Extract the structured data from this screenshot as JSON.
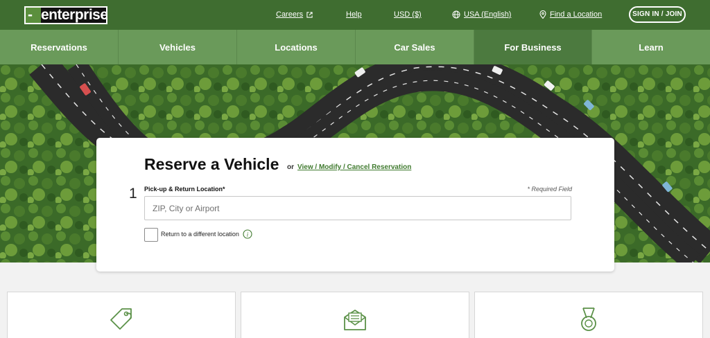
{
  "brand": {
    "logo_text": "enterprise"
  },
  "topbar": {
    "links": [
      {
        "label": "Careers",
        "icon": "external-link-icon"
      },
      {
        "label": "Help"
      },
      {
        "label": "USD ($)"
      },
      {
        "label": "USA (English)",
        "icon": "globe-icon"
      },
      {
        "label": "Find a Location",
        "icon": "location-pin-icon"
      }
    ],
    "signin_label": "SIGN IN / JOIN"
  },
  "nav": {
    "items": [
      {
        "label": "Reservations"
      },
      {
        "label": "Vehicles"
      },
      {
        "label": "Locations"
      },
      {
        "label": "Car Sales"
      },
      {
        "label": "For Business",
        "active": true
      },
      {
        "label": "Learn"
      }
    ]
  },
  "reservation": {
    "title": "Reserve a Vehicle",
    "or_text": "or",
    "modify_link": "View / Modify / Cancel Reservation",
    "step_number": "1",
    "location_label": "Pick-up & Return Location*",
    "required_note": "* Required Field",
    "location_placeholder": "ZIP, City or Airport",
    "location_value": "",
    "return_checkbox_label": "Return to a different location",
    "return_checked": false
  },
  "features": {
    "icons": [
      "price-tag-icon",
      "envelope-icon",
      "medal-icon"
    ]
  },
  "colors": {
    "brand_dark_green": "#3f6d30",
    "nav_green": "#6a9a5a",
    "nav_active_green": "#4c7a3f",
    "link_green": "#3f7a2e",
    "icon_green": "#5b9148"
  }
}
